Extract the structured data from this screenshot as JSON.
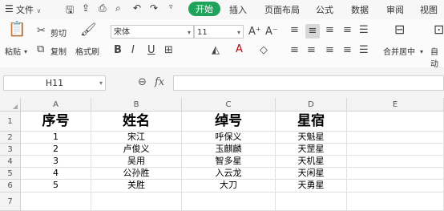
{
  "menu": {
    "file_label": "文件",
    "tabs": [
      "开始",
      "插入",
      "页面布局",
      "公式",
      "数据",
      "审阅",
      "视图"
    ]
  },
  "toolbar": {
    "paste": "粘贴",
    "cut": "剪切",
    "copy": "复制",
    "format_painter": "格式刷",
    "font_name": "宋体",
    "font_size": "11",
    "merge_center": "合并居中",
    "auto": "自动"
  },
  "formula_bar": {
    "name_box": "H11",
    "fx": "fx",
    "formula": ""
  },
  "sheet": {
    "columns": [
      "A",
      "B",
      "C",
      "D",
      "E"
    ],
    "rows": [
      "1",
      "2",
      "3",
      "4",
      "5",
      "6",
      "7"
    ],
    "header_row": [
      "序号",
      "姓名",
      "绰号",
      "星宿"
    ],
    "data_rows": [
      [
        "1",
        "宋江",
        "呼保义",
        "天魁星"
      ],
      [
        "2",
        "卢俊义",
        "玉麒麟",
        "天罡星"
      ],
      [
        "3",
        "吴用",
        "智多星",
        "天机星"
      ],
      [
        "4",
        "公孙胜",
        "入云龙",
        "天闲星"
      ],
      [
        "5",
        "关胜",
        "大刀",
        "天勇星"
      ]
    ]
  }
}
